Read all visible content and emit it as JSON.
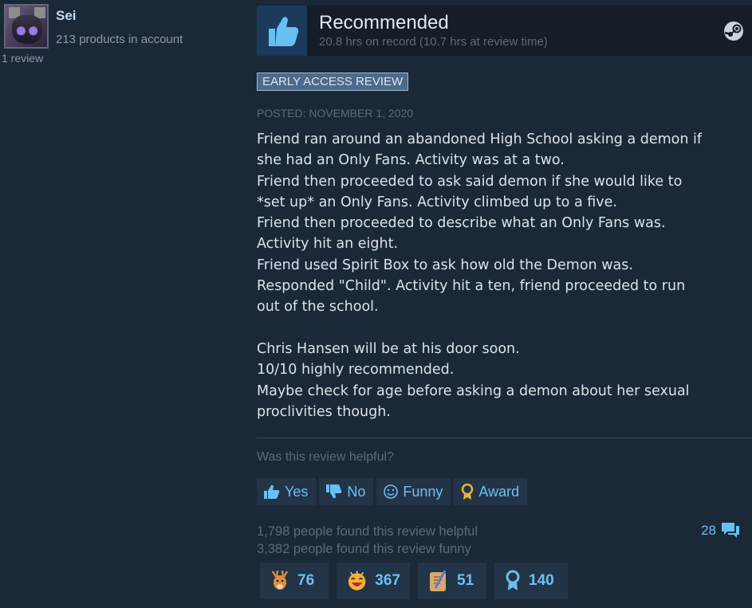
{
  "author": {
    "name": "Sei",
    "products": "213 products in account",
    "reviews": "1 review"
  },
  "header": {
    "title": "Recommended",
    "hours": "20.8 hrs on record (10.7 hrs at review time)"
  },
  "badge": "EARLY ACCESS REVIEW",
  "posted": "POSTED: NOVEMBER 1, 2020",
  "review_lines": [
    "Friend ran around an abandoned High School asking a demon if",
    "she had an Only Fans. Activity was at a two.",
    "Friend then proceeded to ask said demon if she would like to",
    "*set up* an Only Fans. Activity climbed up to a five.",
    "Friend then proceeded to describe what an Only Fans was.",
    "Activity hit an eight.",
    "Friend used Spirit Box to ask how old the Demon was.",
    "Responded \"Child\". Activity hit a ten, friend proceeded to run",
    "out of the school.",
    "",
    "Chris Hansen will be at his door soon.",
    "10/10 highly recommended.",
    "Maybe check for age before asking a demon about her sexual",
    "proclivities though."
  ],
  "helpful_question": "Was this review helpful?",
  "vote_buttons": {
    "yes": "Yes",
    "no": "No",
    "funny": "Funny",
    "award": "Award"
  },
  "stats": {
    "helpful": "1,798 people found this review helpful",
    "funny": "3,382 people found this review funny",
    "comments": "28"
  },
  "awards": [
    {
      "icon": "deer-icon",
      "count": "76"
    },
    {
      "icon": "laughing-face-icon",
      "count": "367"
    },
    {
      "icon": "scroll-quill-icon",
      "count": "51"
    },
    {
      "icon": "ribbon-icon",
      "count": "140"
    }
  ],
  "colors": {
    "background": "#1b2838",
    "accent": "#66c0f4",
    "header_bg": "#141d28"
  }
}
